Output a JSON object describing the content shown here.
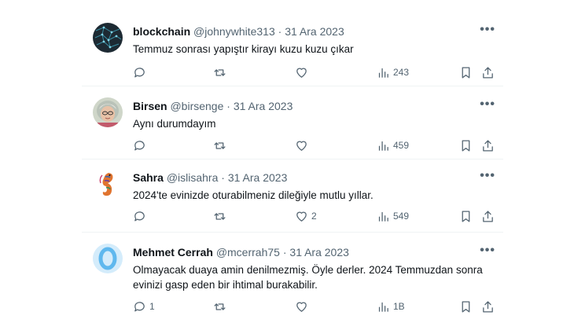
{
  "tweets": [
    {
      "name": "blockchain",
      "handle": "@johnywhite313",
      "sep": "·",
      "date": "31 Ara 2023",
      "text": [
        "Temmuz sonrası yapıştır kirayı kuzu kuzu çıkar"
      ],
      "replies": "",
      "retweets": "",
      "likes": "",
      "views": "243",
      "avatar": "dark-pattern"
    },
    {
      "name": "Birsen",
      "handle": "@birsenge",
      "sep": "·",
      "date": "31 Ara 2023",
      "text": [
        "Aynı durumdayım"
      ],
      "replies": "",
      "retweets": "",
      "likes": "",
      "views": "459",
      "avatar": "photo"
    },
    {
      "name": "Sahra",
      "handle": "@islisahra",
      "sep": "·",
      "date": "31 Ara 2023",
      "text": [
        "2024'te evinizde oturabilmeniz dileğiyle mutlu yıllar."
      ],
      "replies": "",
      "retweets": "",
      "likes": "2",
      "views": "549",
      "avatar": "seahorse"
    },
    {
      "name": "Mehmet Cerrah",
      "handle": "@mcerrah75",
      "sep": "·",
      "date": "31 Ara 2023",
      "text": [
        "Olmayacak duaya amin denilmezmiş. Öyle derler. 2024 Temmuzdan sonra",
        "evinizi gasp eden bir ihtimal burakabilir."
      ],
      "replies": "1",
      "retweets": "",
      "likes": "",
      "views": "1B",
      "avatar": "ring"
    }
  ],
  "icons": {
    "more": "more-icon",
    "reply": "reply-icon",
    "retweet": "retweet-icon",
    "like": "like-icon",
    "views": "views-icon",
    "bookmark": "bookmark-icon",
    "share": "share-icon"
  },
  "colors": {
    "text": "#0f1419",
    "muted": "#536471",
    "divider": "#eff3f4"
  }
}
